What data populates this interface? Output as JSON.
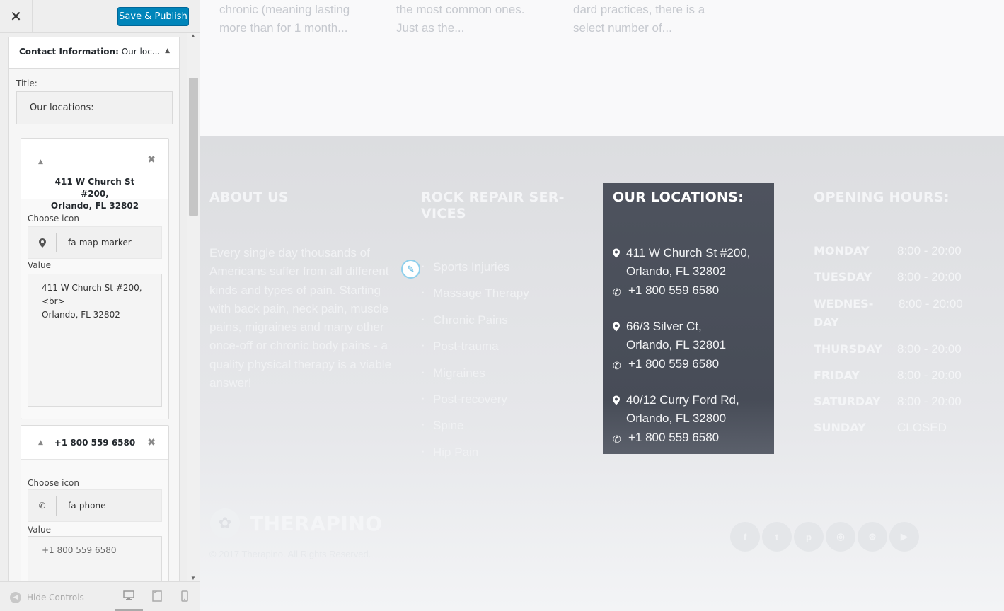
{
  "customizer": {
    "close_glyph": "✕",
    "save_button": "Save & Publish",
    "widget": {
      "header_bold": "Contact Information:",
      "header_rest": "Our loc...",
      "title_label": "Title:",
      "title_value": "Our locations:",
      "items": [
        {
          "heading": "411 W Church St\n#200,\nOrlando, FL 32802",
          "choose_icon_label": "Choose icon",
          "icon_value": "fa-map-marker",
          "value_label": "Value",
          "value_text": "411 W Church St #200,\n<br>\nOrlando, FL 32802"
        },
        {
          "heading": "+1 800 559 6580",
          "choose_icon_label": "Choose icon",
          "icon_value": "fa-phone",
          "value_label": "Value",
          "value_text": "+1 800 559 6580"
        }
      ]
    },
    "footer": {
      "hide_controls": "Hide Controls"
    }
  },
  "preview": {
    "excerpts": [
      "chronic (meaning lasting\nmore than for 1 month...",
      "the most common ones.\nJust as the...",
      "dard practices, there is a\nselect number of..."
    ],
    "about": {
      "title": "ABOUT US",
      "text": "Every single day thousands of Americans suffer from all different kinds and types of pain. Starting with back pain, neck pain, muscle pains, migraines and many other once-off or chronic body pains - a quality physical therapy is a viable answer!"
    },
    "services": {
      "title": "ROCK REPAIR SER-\nVICES",
      "items": [
        "Sports Injuries",
        "Massage Therapy",
        "Chronic Pains",
        "Post-trauma",
        "Migraines",
        "Post-recovery",
        "Spine",
        "Hip Pain"
      ]
    },
    "locations": {
      "title": "OUR LOCATIONS:",
      "entries": [
        {
          "address": "411 W Church St #200,\nOrlando, FL 32802",
          "phone": "+1 800 559 6580"
        },
        {
          "address": "66/3 Silver Ct,\nOrlando, FL 32801",
          "phone": "+1 800 559 6580"
        },
        {
          "address": "40/12 Curry Ford Rd,\nOrlando, FL 32800",
          "phone": "+1 800 559 6580"
        }
      ]
    },
    "hours": {
      "title": "OPENING HOURS:",
      "rows": [
        {
          "day": "MONDAY",
          "time": "8:00 - 20:00"
        },
        {
          "day": "TUESDAY",
          "time": "8:00 - 20:00"
        },
        {
          "day": "WEDNES-\nDAY",
          "time": "8:00 - 20:00"
        },
        {
          "day": "THURSDAY",
          "time": "8:00 - 20:00"
        },
        {
          "day": "FRIDAY",
          "time": "8:00 - 20:00"
        },
        {
          "day": "SATURDAY",
          "time": "8:00 - 20:00"
        },
        {
          "day": "SUNDAY",
          "time": "CLOSED"
        }
      ]
    },
    "brand": {
      "name": "THERAPINO",
      "copyright": "© 2017 Therapino. All Rights Reserved."
    },
    "social_icons": [
      "facebook-icon",
      "twitter-icon",
      "pinterest-icon",
      "instagram-icon",
      "dribbble-icon",
      "youtube-icon"
    ]
  }
}
